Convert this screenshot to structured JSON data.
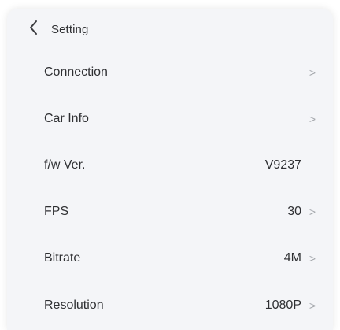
{
  "header": {
    "title": "Setting"
  },
  "rows": [
    {
      "label": "Connection",
      "value": "",
      "chevron": ">"
    },
    {
      "label": "Car Info",
      "value": "",
      "chevron": ">"
    },
    {
      "label": "f/w Ver.",
      "value": "V9237",
      "chevron": ""
    },
    {
      "label": "FPS",
      "value": "30",
      "chevron": ">"
    },
    {
      "label": "Bitrate",
      "value": "4M",
      "chevron": ">"
    },
    {
      "label": "Resolution",
      "value": "1080P",
      "chevron": ">"
    }
  ]
}
